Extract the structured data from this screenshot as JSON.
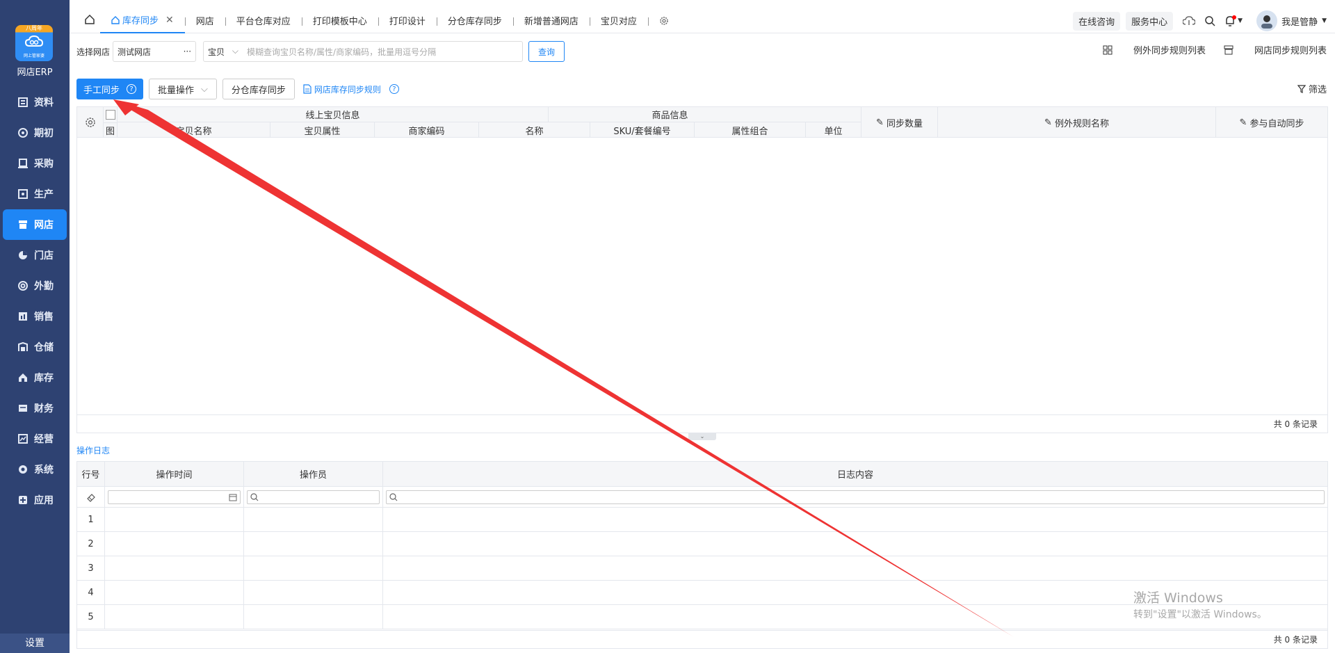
{
  "sidebar": {
    "logo_tag": "八周年",
    "logo_sub": "网上管家婆",
    "app_title": "网店ERP",
    "items": [
      {
        "label": "资料",
        "icon": "database-icon"
      },
      {
        "label": "期初",
        "icon": "target-icon"
      },
      {
        "label": "采购",
        "icon": "purchase-icon"
      },
      {
        "label": "生产",
        "icon": "production-icon"
      },
      {
        "label": "网店",
        "icon": "store-icon",
        "active": true
      },
      {
        "label": "门店",
        "icon": "pie-icon"
      },
      {
        "label": "外勤",
        "icon": "field-icon"
      },
      {
        "label": "销售",
        "icon": "sales-icon"
      },
      {
        "label": "仓储",
        "icon": "warehouse-icon"
      },
      {
        "label": "库存",
        "icon": "inventory-icon"
      },
      {
        "label": "财务",
        "icon": "finance-icon"
      },
      {
        "label": "经营",
        "icon": "chart-icon"
      },
      {
        "label": "系统",
        "icon": "system-icon"
      },
      {
        "label": "应用",
        "icon": "app-icon"
      }
    ],
    "settings": "设置"
  },
  "tabs": [
    {
      "label": "库存同步",
      "active": true
    },
    {
      "label": "网店"
    },
    {
      "label": "平台仓库对应"
    },
    {
      "label": "打印模板中心"
    },
    {
      "label": "打印设计"
    },
    {
      "label": "分仓库存同步"
    },
    {
      "label": "新增普通网店"
    },
    {
      "label": "宝贝对应"
    }
  ],
  "topbar": {
    "online_consult": "在线咨询",
    "service_center": "服务中心",
    "user_name": "我是管静"
  },
  "filter": {
    "shop_label": "选择网店",
    "shop_value": "测试网店",
    "search_type": "宝贝",
    "search_placeholder": "模糊查询宝贝名称/属性/商家编码，批量用逗号分隔",
    "query": "查询",
    "exception_rules": "例外同步规则列表",
    "shop_rules": "网店同步规则列表"
  },
  "actions": {
    "manual_sync": "手工同步",
    "batch": "批量操作",
    "split_sync": "分仓库存同步",
    "rule_link": "网店库存同步规则",
    "filter": "筛选"
  },
  "main_table": {
    "group_online": "线上宝贝信息",
    "group_product": "商品信息",
    "col_img": "图",
    "col_name": "宝贝名称",
    "col_attr": "宝贝属性",
    "col_code": "商家编码",
    "col_pname": "名称",
    "col_sku": "SKU/套餐编号",
    "col_combo": "属性组合",
    "col_unit": "单位",
    "col_qty": "同步数量",
    "col_rule": "例外规则名称",
    "col_auto": "参与自动同步",
    "footer": "共 0 条记录"
  },
  "log": {
    "title": "操作日志",
    "col_no": "行号",
    "col_time": "操作时间",
    "col_user": "操作员",
    "col_content": "日志内容",
    "rows": [
      "1",
      "2",
      "3",
      "4",
      "5"
    ],
    "footer": "共 0 条记录"
  },
  "watermark": {
    "line1": "激活 Windows",
    "line2": "转到\"设置\"以激活 Windows。"
  },
  "colors": {
    "sidebar_bg": "#2e4272",
    "accent": "#1f86f5",
    "annotation_arrow": "#ee3333"
  }
}
